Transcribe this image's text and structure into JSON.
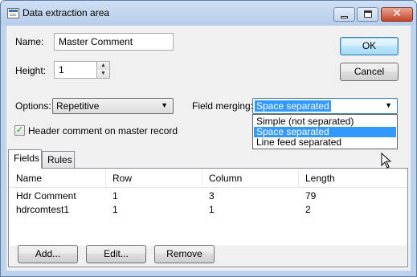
{
  "window": {
    "title": "Data extraction area"
  },
  "name_field": {
    "label": "Name:",
    "value": "Master Comment"
  },
  "height_field": {
    "label": "Height:",
    "value": "1"
  },
  "buttons": {
    "ok": "OK",
    "cancel": "Cancel",
    "add": "Add...",
    "edit": "Edit...",
    "remove": "Remove"
  },
  "options": {
    "label": "Options:",
    "value": "Repetitive"
  },
  "field_merging": {
    "label": "Field merging:",
    "value": "Space separated",
    "dropdown_options": [
      "Simple (not separated)",
      "Space separated",
      "Line feed separated"
    ],
    "highlighted_option": "Space separated"
  },
  "header_comment": {
    "label": "Header comment on master record",
    "checked": true
  },
  "tabs": [
    {
      "label": "Fields",
      "active": true
    },
    {
      "label": "Rules",
      "active": false
    }
  ],
  "table": {
    "columns": [
      "Name",
      "Row",
      "Column",
      "Length"
    ],
    "rows": [
      [
        "Hdr Comment",
        "1",
        "3",
        "79"
      ],
      [
        "hdrcomtest1",
        "1",
        "1",
        "2"
      ]
    ]
  },
  "icons": {
    "app": "window-icon",
    "minimize": "minimize-icon",
    "maximize": "maximize-icon",
    "close": "close-icon",
    "check": "checkmark-icon",
    "dropdown": "chevron-down-icon",
    "spin_up": "spin-up-icon",
    "spin_down": "spin-down-icon",
    "cursor": "mouse-pointer-icon"
  },
  "colors": {
    "selection": "#3399ff",
    "title_bar": "#c4d8f0",
    "close_button": "#c7442b",
    "default_button_border": "#3c7fb1"
  }
}
